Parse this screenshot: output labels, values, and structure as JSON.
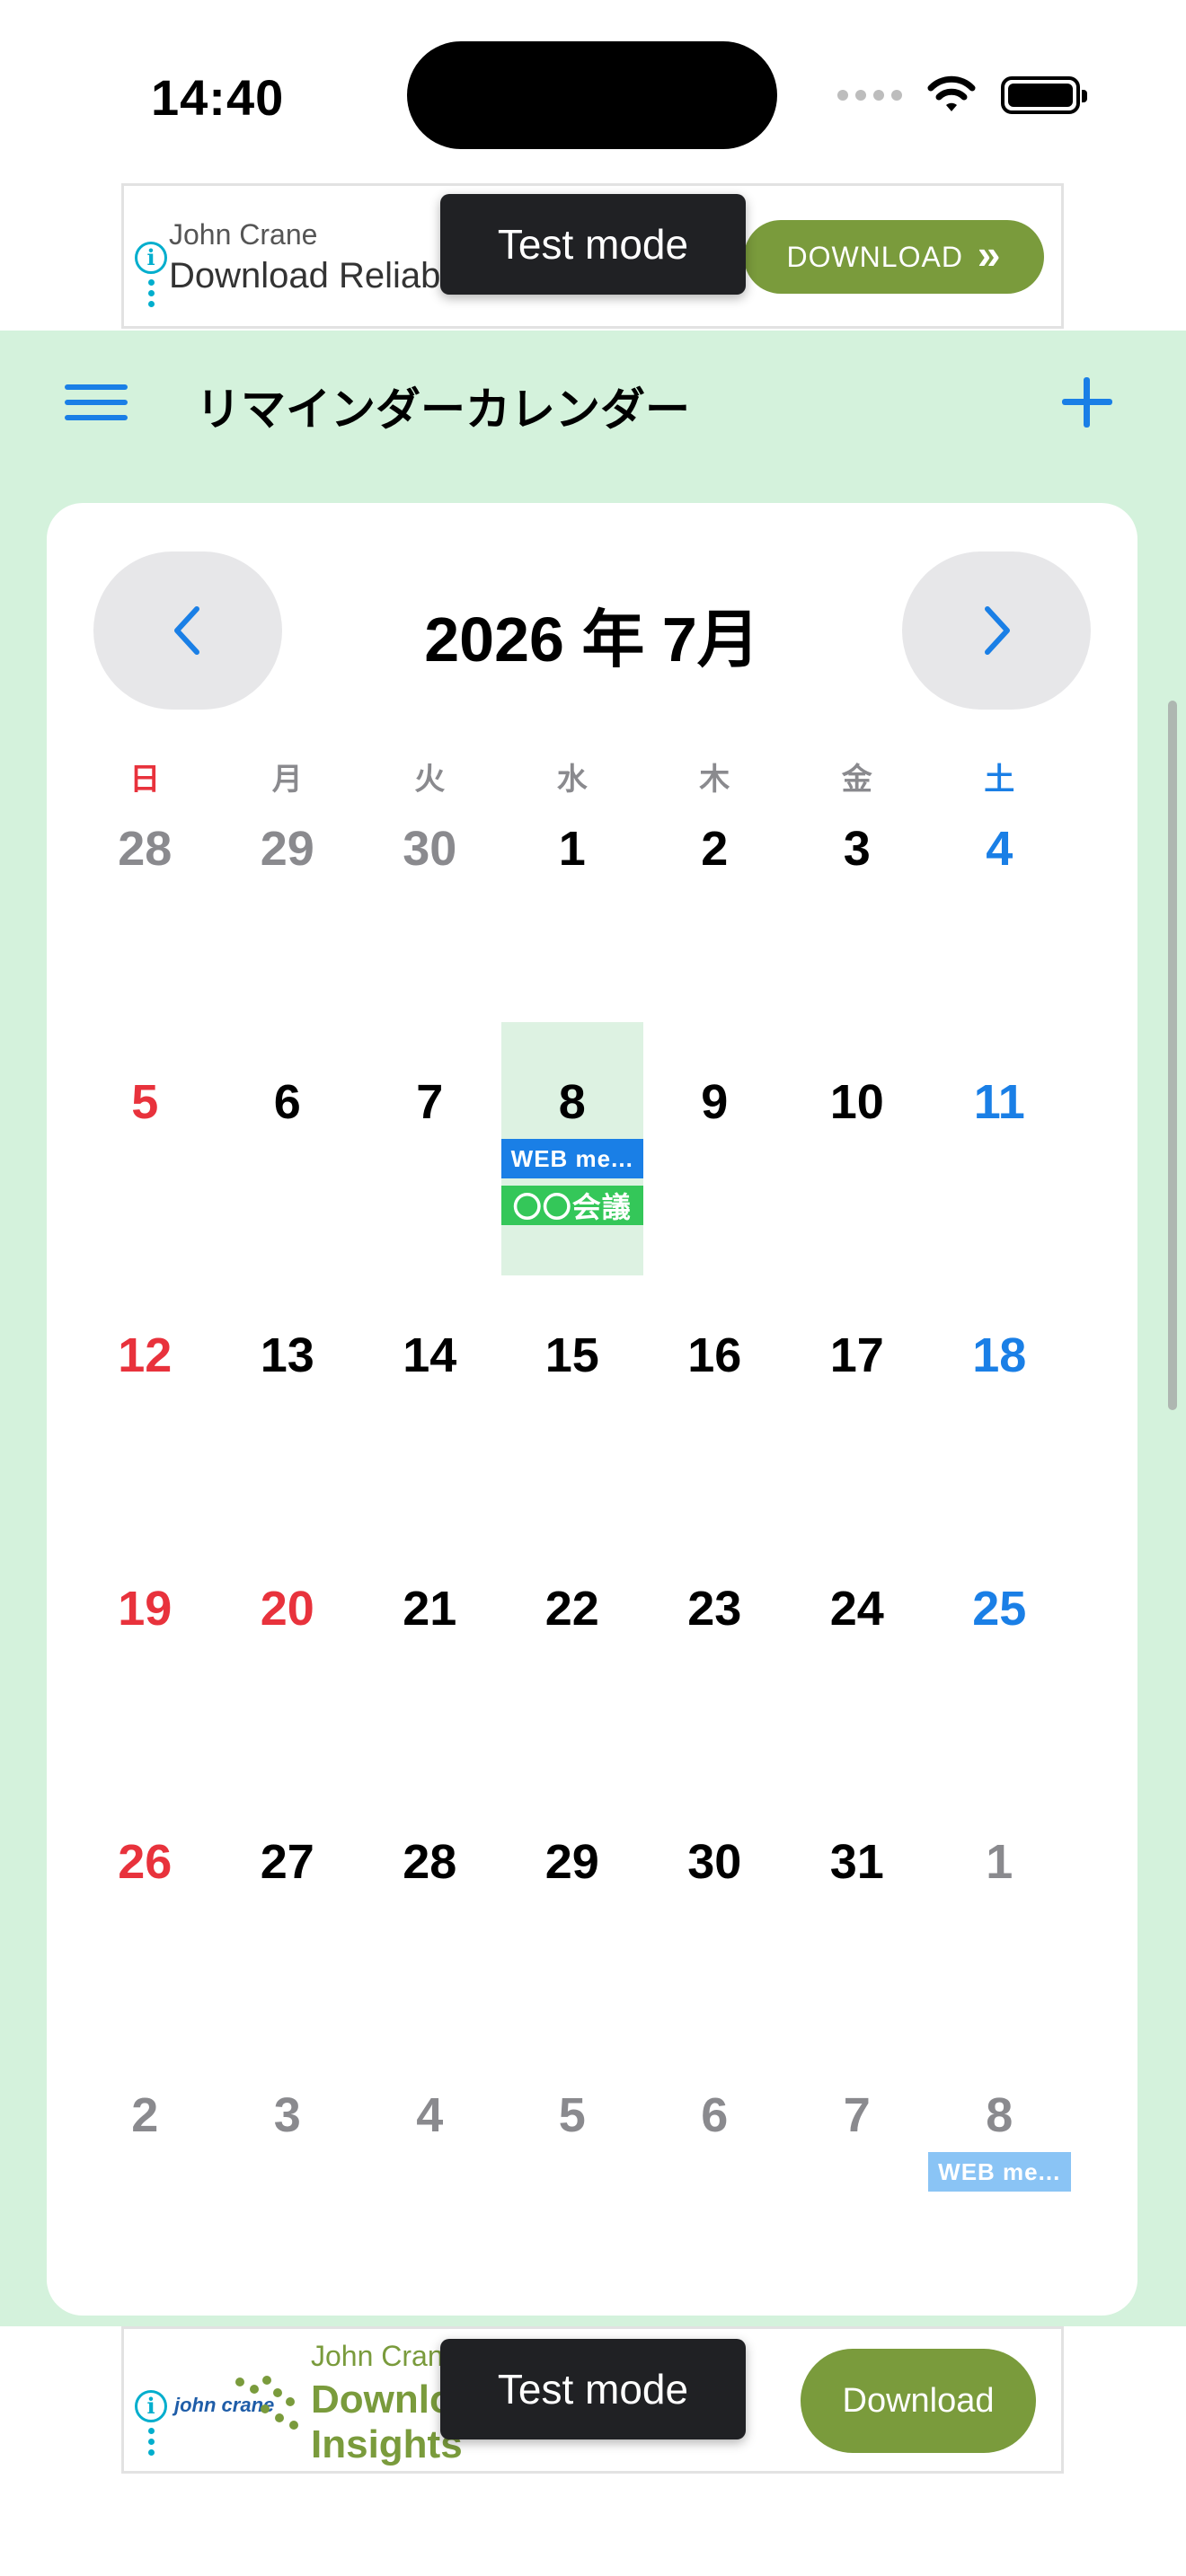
{
  "status": {
    "time": "14:40"
  },
  "ads": {
    "top": {
      "sponsor": "John Crane",
      "headline": "Download Reliab",
      "button": "DOWNLOAD"
    },
    "bottom": {
      "sponsor": "John Cran",
      "headline": "Downlo Insights",
      "logo_text": "john crane",
      "button": "Download"
    },
    "toast": "Test mode"
  },
  "app": {
    "title": "リマインダーカレンダー"
  },
  "calendar": {
    "month_title": "2026 年 7月",
    "weekdays": [
      "日",
      "月",
      "火",
      "水",
      "木",
      "金",
      "土"
    ],
    "weeks": [
      [
        {
          "d": "28",
          "o": true
        },
        {
          "d": "29",
          "o": true
        },
        {
          "d": "30",
          "o": true
        },
        {
          "d": "1"
        },
        {
          "d": "2"
        },
        {
          "d": "3"
        },
        {
          "d": "4"
        }
      ],
      [
        {
          "d": "5"
        },
        {
          "d": "6"
        },
        {
          "d": "7"
        },
        {
          "d": "8",
          "sel": true,
          "events": [
            {
              "t": "WEB me...",
              "c": "blue"
            },
            {
              "t": "〇〇会議",
              "c": "green"
            }
          ]
        },
        {
          "d": "9"
        },
        {
          "d": "10"
        },
        {
          "d": "11"
        }
      ],
      [
        {
          "d": "12"
        },
        {
          "d": "13"
        },
        {
          "d": "14"
        },
        {
          "d": "15"
        },
        {
          "d": "16"
        },
        {
          "d": "17"
        },
        {
          "d": "18"
        }
      ],
      [
        {
          "d": "19"
        },
        {
          "d": "20",
          "hol": true
        },
        {
          "d": "21"
        },
        {
          "d": "22"
        },
        {
          "d": "23"
        },
        {
          "d": "24"
        },
        {
          "d": "25"
        }
      ],
      [
        {
          "d": "26"
        },
        {
          "d": "27"
        },
        {
          "d": "28"
        },
        {
          "d": "29"
        },
        {
          "d": "30"
        },
        {
          "d": "31"
        },
        {
          "d": "1",
          "o": true
        }
      ],
      [
        {
          "d": "2",
          "o": true
        },
        {
          "d": "3",
          "o": true
        },
        {
          "d": "4",
          "o": true
        },
        {
          "d": "5",
          "o": true
        },
        {
          "d": "6",
          "o": true
        },
        {
          "d": "7",
          "o": true
        },
        {
          "d": "8",
          "o": true,
          "events": [
            {
              "t": "WEB me...",
              "c": "light"
            }
          ]
        }
      ]
    ]
  },
  "colors": {
    "accent": "#1a7fe6",
    "sunday": "#e8323c",
    "app_bg": "#d4f2dc",
    "ad_green": "#7a9b3c"
  }
}
